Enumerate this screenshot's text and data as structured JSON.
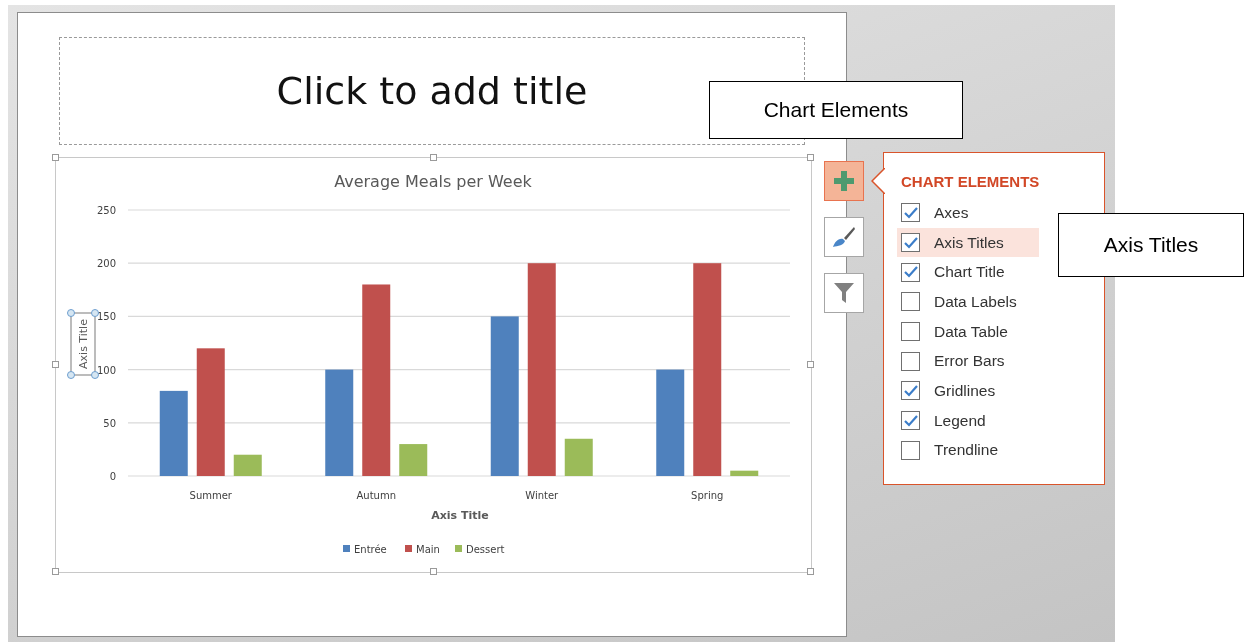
{
  "slide": {
    "title_placeholder": "Click to add title"
  },
  "chart": {
    "chart_data": {
      "type": "bar",
      "title": "Average Meals per Week",
      "xlabel": "Axis Title",
      "ylabel": "Axis Title",
      "categories": [
        "Summer",
        "Autumn",
        "Winter",
        "Spring"
      ],
      "series": [
        {
          "name": "Entrée",
          "color": "#4f81bd",
          "values": [
            80,
            100,
            150,
            100
          ]
        },
        {
          "name": "Main",
          "color": "#c0504d",
          "values": [
            120,
            180,
            200,
            200
          ]
        },
        {
          "name": "Dessert",
          "color": "#9bbb59",
          "values": [
            20,
            30,
            35,
            5
          ]
        }
      ],
      "grid": true,
      "legend": true,
      "ylim": [
        0,
        250
      ],
      "yticks": [
        0,
        50,
        100,
        150,
        200,
        250
      ]
    }
  },
  "side_buttons": [
    {
      "kind": "add",
      "selected": true
    },
    {
      "kind": "style",
      "selected": false
    },
    {
      "kind": "filter",
      "selected": false
    }
  ],
  "panel": {
    "title": "CHART ELEMENTS",
    "items": [
      {
        "label": "Axes",
        "checked": true,
        "selected": false
      },
      {
        "label": "Axis Titles",
        "checked": true,
        "selected": true
      },
      {
        "label": "Chart Title",
        "checked": true,
        "selected": false
      },
      {
        "label": "Data Labels",
        "checked": false,
        "selected": false
      },
      {
        "label": "Data Table",
        "checked": false,
        "selected": false
      },
      {
        "label": "Error Bars",
        "checked": false,
        "selected": false
      },
      {
        "label": "Gridlines",
        "checked": true,
        "selected": false
      },
      {
        "label": "Legend",
        "checked": true,
        "selected": false
      },
      {
        "label": "Trendline",
        "checked": false,
        "selected": false
      }
    ]
  },
  "callouts": [
    {
      "text": "Chart Elements"
    },
    {
      "text": "Axis Titles"
    }
  ]
}
